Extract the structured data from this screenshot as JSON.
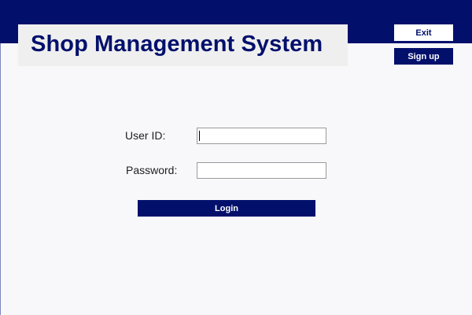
{
  "header": {
    "title": "Shop Management System",
    "band_color": "#03106b",
    "exit_label": "Exit",
    "signup_label": "Sign up"
  },
  "login_form": {
    "user_id_label": "User ID:",
    "user_id_value": "",
    "password_label": "Password:",
    "password_value": "",
    "login_label": "Login"
  },
  "colors": {
    "accent": "#03106b",
    "background": "#f8f8fa",
    "title_box": "#efefef"
  }
}
